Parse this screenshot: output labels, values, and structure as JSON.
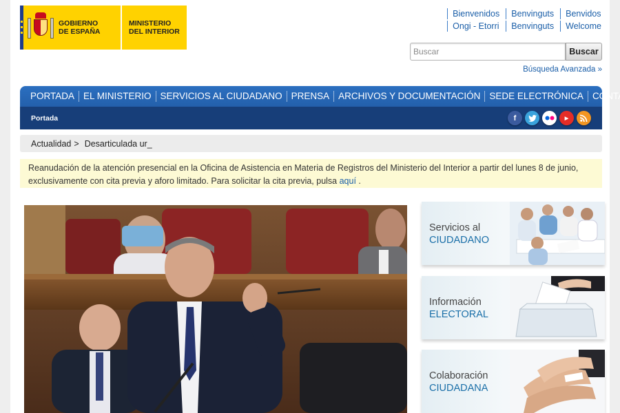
{
  "header": {
    "logo_gobierno_line1": "GOBIERNO",
    "logo_gobierno_line2": "DE ESPAÑA",
    "logo_ministerio_line1": "MINISTERIO",
    "logo_ministerio_line2": "DEL INTERIOR",
    "languages": [
      "Bienvenidos",
      "Benvinguts",
      "Benvidos",
      "Ongi - Etorri",
      "Benvinguts",
      "Welcome"
    ],
    "search_placeholder": "Buscar",
    "search_button": "Buscar",
    "advanced_search": "Búsqueda Avanzada »"
  },
  "nav": {
    "items": [
      "PORTADA",
      "EL MINISTERIO",
      "SERVICIOS AL CIUDADANO",
      "PRENSA",
      "ARCHIVOS Y DOCUMENTACIÓN",
      "SEDE ELECTRÓNICA",
      "CONTACTO"
    ],
    "sub_label": "Portada",
    "social_icons": [
      "facebook-icon",
      "twitter-icon",
      "flickr-icon",
      "youtube-icon",
      "rss-icon"
    ]
  },
  "breadcrumb": {
    "parent": "Actualidad",
    "separator": ">",
    "current": "Desarticulada ur_"
  },
  "notice": {
    "text": "Reanudación de la atención presencial en la Oficina de Asistencia en Materia de Registros del Ministerio del Interior a partir del lunes 8 de junio, exclusivamente con cita previa y aforo limitado. Para solicitar la cita previa, pulsa ",
    "link": "aquí",
    "tail": " ."
  },
  "banners": [
    {
      "line1": "Servicios al",
      "line2": "CIUDADANO"
    },
    {
      "line1": "Información",
      "line2": "ELECTORAL"
    },
    {
      "line1": "Colaboración",
      "line2": "CIUDADANA"
    }
  ],
  "colors": {
    "nav_top": "#2b6fc0",
    "nav_bottom": "#173e79",
    "link": "#1a5ea8",
    "logo_yellow": "#ffd200",
    "notice_bg": "#fdfad4"
  }
}
